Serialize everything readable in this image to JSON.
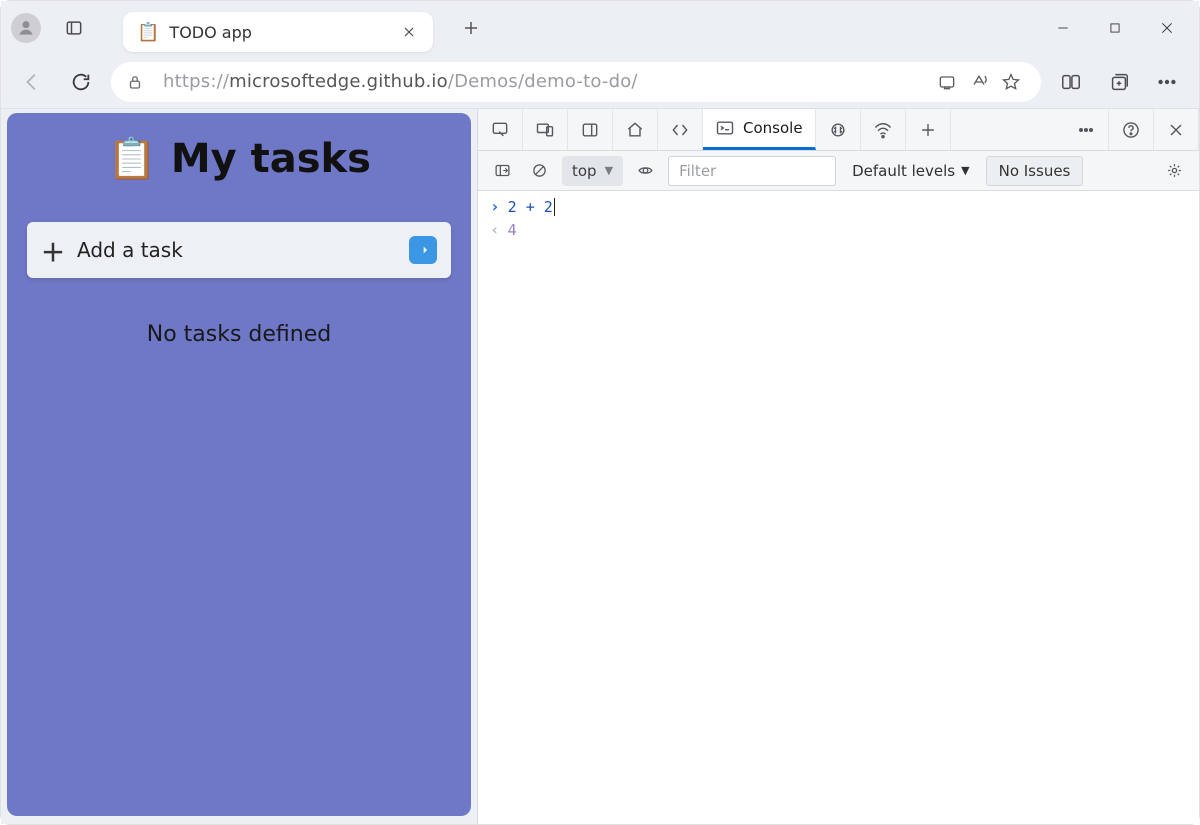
{
  "tabs": [
    {
      "title": "TODO app",
      "favicon": "📋"
    }
  ],
  "url": {
    "scheme": "https://",
    "host": "microsoftedge.github.io",
    "path": "/Demos/demo-to-do/"
  },
  "page": {
    "heading": "My tasks",
    "heading_icon": "📋",
    "add_placeholder": "Add a task",
    "empty_state": "No tasks defined"
  },
  "devtools": {
    "active_tab": "Console",
    "context": "top",
    "filter_placeholder": "Filter",
    "levels_label": "Default levels",
    "issues_label": "No Issues",
    "console": {
      "input_expression": "2 + 2",
      "output_value": "4"
    }
  }
}
